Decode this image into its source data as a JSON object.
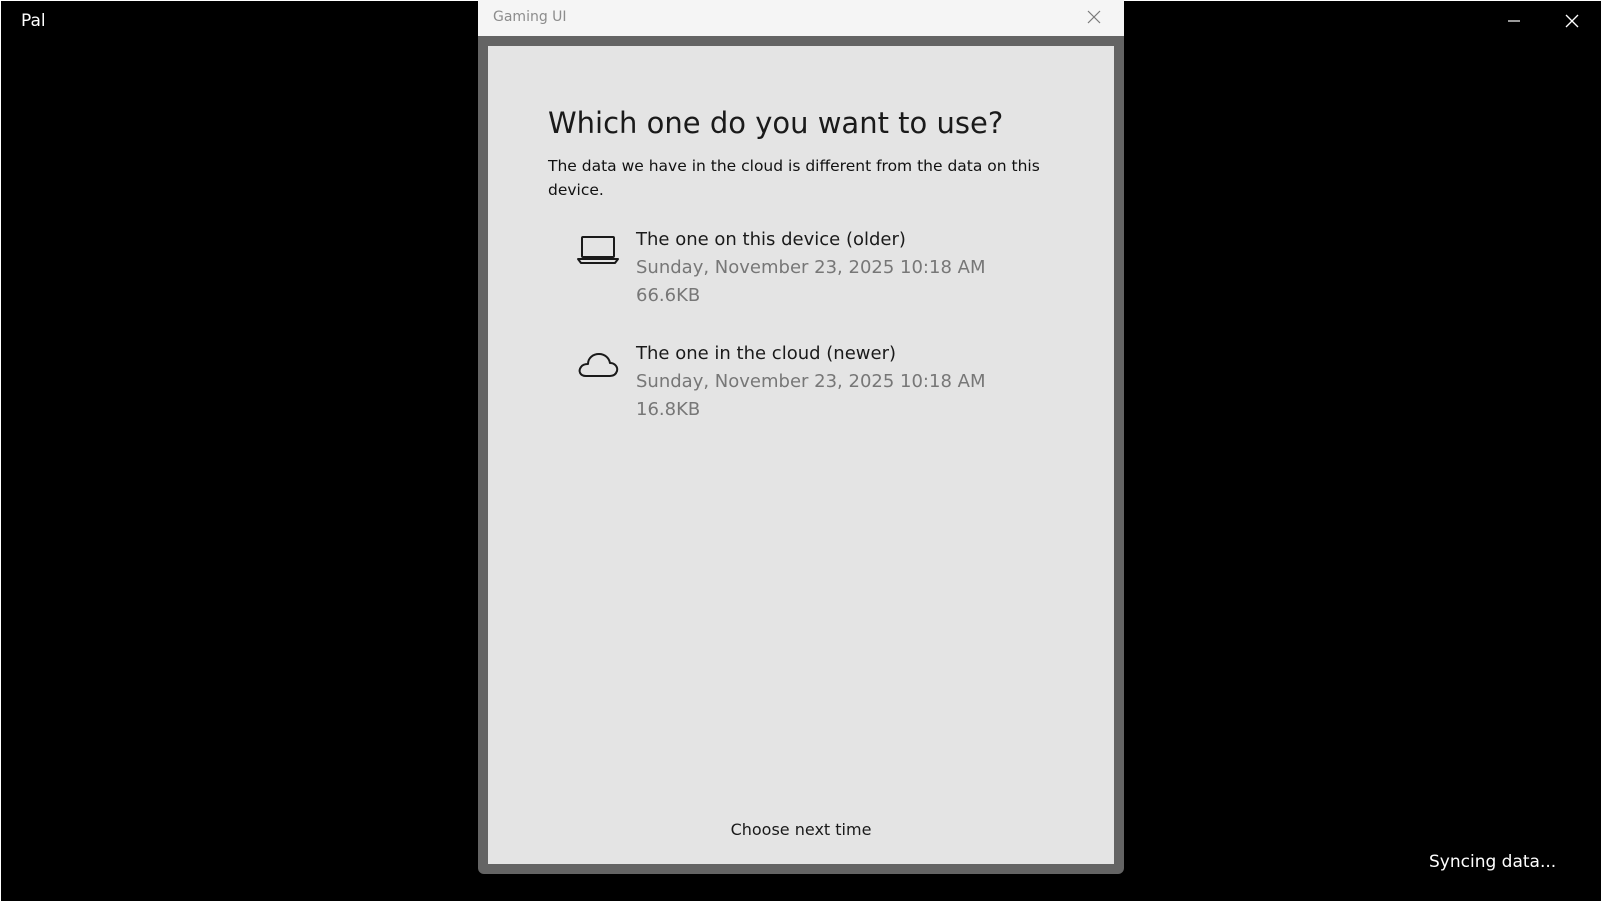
{
  "app": {
    "title": "Pal",
    "status": "Syncing data...",
    "icons": {
      "minimize": "minimize-icon",
      "close": "close-icon"
    }
  },
  "dialog": {
    "title": "Gaming UI",
    "heading": "Which one do you want to use?",
    "description": "The data we have in the cloud is different from the data on this device.",
    "options": [
      {
        "icon": "laptop-icon",
        "title": "The one on this device (older)",
        "date": "Sunday, November 23, 2025 10:18 AM",
        "size": "66.6KB"
      },
      {
        "icon": "cloud-icon",
        "title": "The one in the cloud (newer)",
        "date": "Sunday, November 23, 2025 10:18 AM",
        "size": "16.8KB"
      }
    ],
    "secondary_action": "Choose next time"
  },
  "colors": {
    "app_background": "#000000",
    "dialog_frame": "#646464",
    "dialog_titlebar": "#f5f5f5",
    "dialog_body": "#e4e4e4",
    "meta_text": "#777777"
  }
}
